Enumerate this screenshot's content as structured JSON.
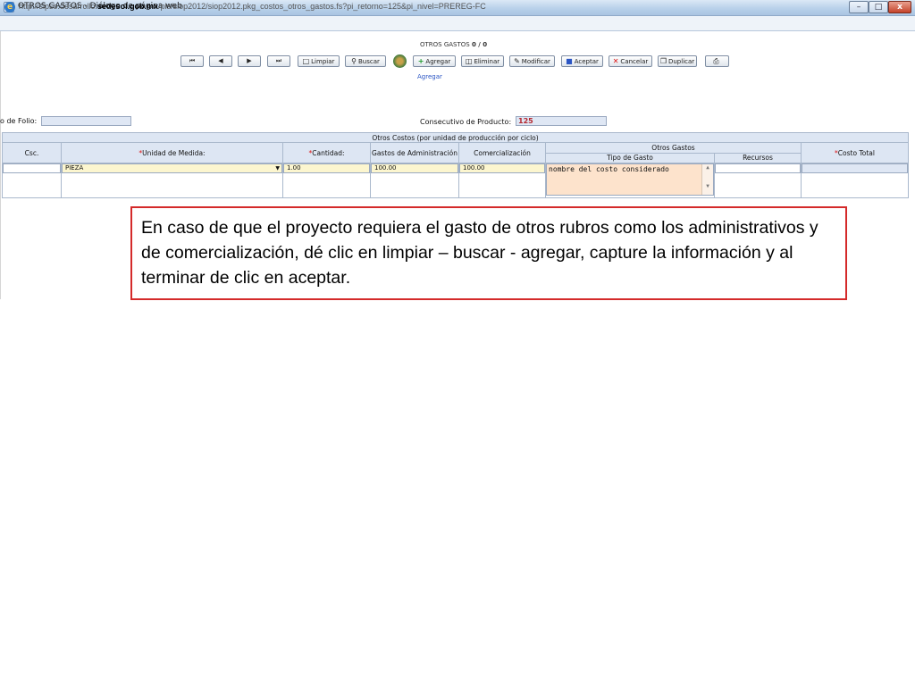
{
  "window": {
    "title": "OTROS GASTOS - Diálogo de página web",
    "url_prefix": "http://sipso.desarrollo.",
    "url_domain": "sedesol.gob.mx",
    "url_path": "/pls/siop2012/siop2012.pkg_costos_otros_gastos.fs?pi_retorno=125&pi_nivel=PREREG-FC",
    "min_label": "–",
    "max_label": "□",
    "close_label": "x"
  },
  "toolbar": {
    "record_title": "OTROS GASTOS",
    "record_count": "0 / 0",
    "first": "⏮",
    "prev": "◀",
    "next": "▶",
    "last": "⏭",
    "limpiar": "Limpiar",
    "buscar": "Buscar",
    "agregar": "Agregar",
    "eliminar": "Eliminar",
    "modificar": "Modificar",
    "aceptar": "Aceptar",
    "cancelar": "Cancelar",
    "duplicar": "Duplicar",
    "mode_label": "Agregar"
  },
  "form": {
    "folio_label": "o de Folio:",
    "folio_value": "",
    "consecutivo_label": "Consecutivo de Producto:",
    "consecutivo_value": "125"
  },
  "table": {
    "caption": "Otros Costos (por unidad de producción por ciclo)",
    "columns": {
      "csc": "Csc.",
      "unidad": "Unidad de Medida:",
      "cantidad": "Cantidad:",
      "gastos_admin": "Gastos de Administración",
      "comercializacion": "Comercialización",
      "otros_gastos": "Otros Gastos",
      "tipo_gasto": "Tipo de Gasto",
      "recursos": "Recursos",
      "costo_total": "Costo Total"
    },
    "required_mark": "*",
    "row": {
      "csc": "",
      "unidad": "PIEZA",
      "cantidad": "1.00",
      "gastos_admin": "100.00",
      "comercializacion": "100.00",
      "tipo_gasto": "nombre del costo considerado",
      "recursos": "",
      "costo_total": ""
    }
  },
  "callout": {
    "text": "En caso de que el proyecto requiera el gasto de otros rubros como los administrativos y de comercialización, dé clic en limpiar – buscar - agregar, capture la información y al terminar de clic en aceptar."
  }
}
